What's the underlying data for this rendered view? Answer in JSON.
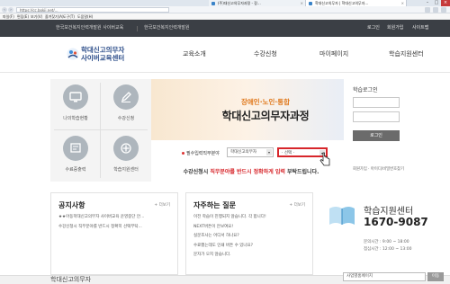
{
  "browser": {
    "tabs": [
      "(주)대신고의무자과정 - 장...",
      "학대신고의무자 | 학대신고의무자..."
    ],
    "url": "https://cc.bokji.net/...",
    "menu": [
      "파일(F)",
      "편집(E)",
      "보기(V)",
      "즐겨찾기(A)",
      "도구(T)",
      "도움말(H)"
    ]
  },
  "topbar": {
    "left_links": [
      "한국보건복지인력개발원 사이버교육",
      "한국보건복지인력개발원"
    ],
    "right_links": [
      "로그인",
      "회원가입",
      "사이트맵"
    ]
  },
  "header": {
    "logo_line1": "학대신고의무자",
    "logo_line2": "사이버교육센터",
    "nav": [
      "교육소개",
      "수강신청",
      "마이페이지",
      "학습지원센터"
    ]
  },
  "quick_menu": [
    "나의학습현황",
    "수강신청",
    "수료증출력",
    "학습지원센터"
  ],
  "banner": {
    "subtitle": "장애인·노인·통합",
    "title": "학대신고의무자과정",
    "field_label": "필수입력직무분야",
    "select1": "학대신고의무자",
    "select2": "· 선택 ·",
    "notice_prefix": "수강신청시 ",
    "notice_highlight": "직무분야를 반드시 정확하게 입력",
    "notice_suffix": " 부탁드립니다."
  },
  "login": {
    "title": "학습로그인",
    "button": "로그인",
    "links": "회원가입 · 아이디/비밀번호찾기"
  },
  "notice_box": {
    "title": "공지사항",
    "more": "+ 더보기",
    "items": [
      "★★아동학대신고의무자 사이버교육 운영중단 안...",
      "수강신청시 직무분야를 반드시 정확히 선택부탁..."
    ]
  },
  "faq_box": {
    "title": "자주하는 질문",
    "more": "+ 더보기",
    "items": [
      "이전 학습이 진행되지 않습니다. 각 합니다!",
      "NEXT버튼이 안보여요!",
      "실문조사는 어디서 하나요?",
      "수료했는데도 인쇄 버튼 수 있나요?",
      "문자가 오지 않습니다."
    ]
  },
  "support": {
    "title": "학습지원센터",
    "phone": "1670-9087",
    "hours1": "문의시간 : 9:00 ~ 18:00",
    "hours2": "점심시간 : 12:00 ~ 13:00"
  },
  "footer": {
    "text": "학대신고의무자",
    "select": "사업별홈페이지",
    "go": "이동"
  }
}
